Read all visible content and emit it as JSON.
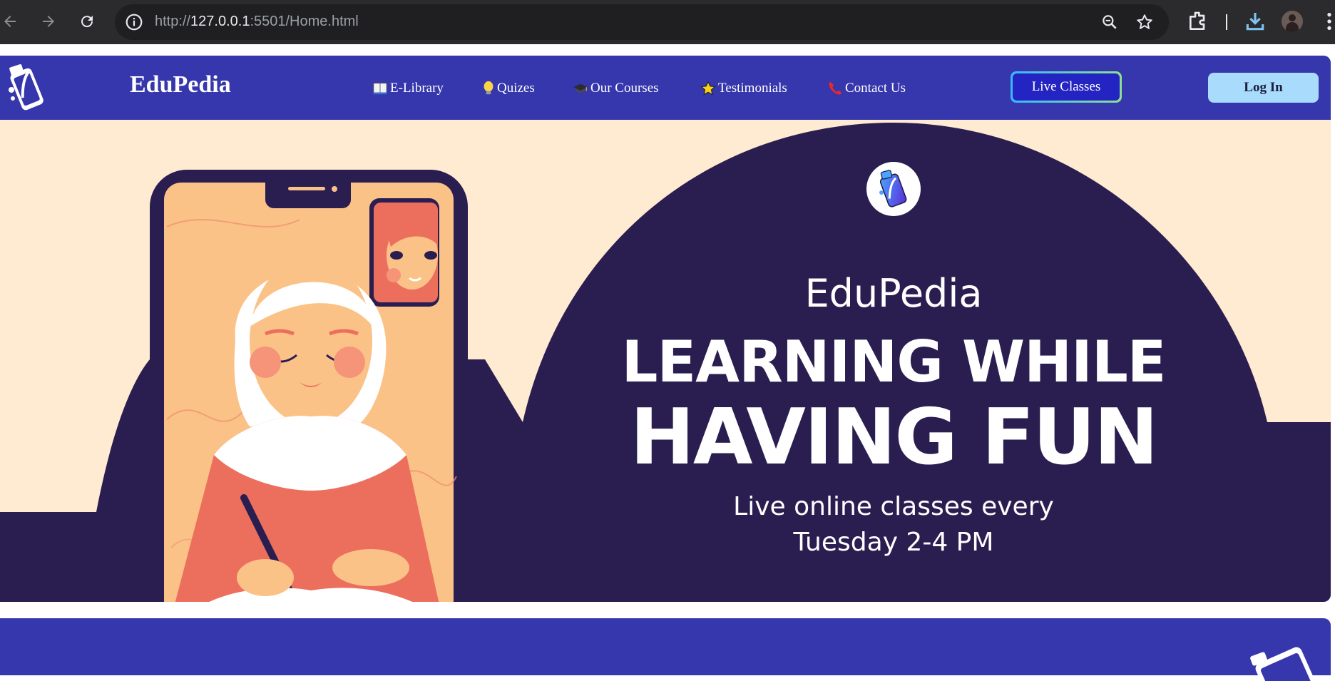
{
  "browser": {
    "url_scheme": "http://",
    "url_host": "127.0.0.1",
    "url_rest": ":5501/Home.html"
  },
  "site": {
    "brand": "EduPedia",
    "menu": [
      {
        "label": "E-Library",
        "icon": "book-icon"
      },
      {
        "label": "Quizes",
        "icon": "lightbulb-icon"
      },
      {
        "label": "Our Courses",
        "icon": "graduation-cap-icon"
      },
      {
        "label": "Testimonials",
        "icon": "star-icon"
      },
      {
        "label": "Contact Us",
        "icon": "telephone-icon"
      }
    ],
    "live_classes_label": "Live Classes",
    "login_label": "Log In"
  },
  "hero": {
    "title": "EduPedia",
    "headline_line1": "LEARNING WHILE",
    "headline_line2": "HAVING FUN",
    "subtitle_line1": "Live online classes every",
    "subtitle_line2": "Tuesday 2-4 PM"
  },
  "colors": {
    "header_bg": "#3636ad",
    "hero_bg": "#ffebd1",
    "hero_dark": "#2a1e50",
    "login_bg": "#a9dcfc",
    "accent_coral": "#ec6f5e",
    "accent_peach": "#fbc287"
  }
}
